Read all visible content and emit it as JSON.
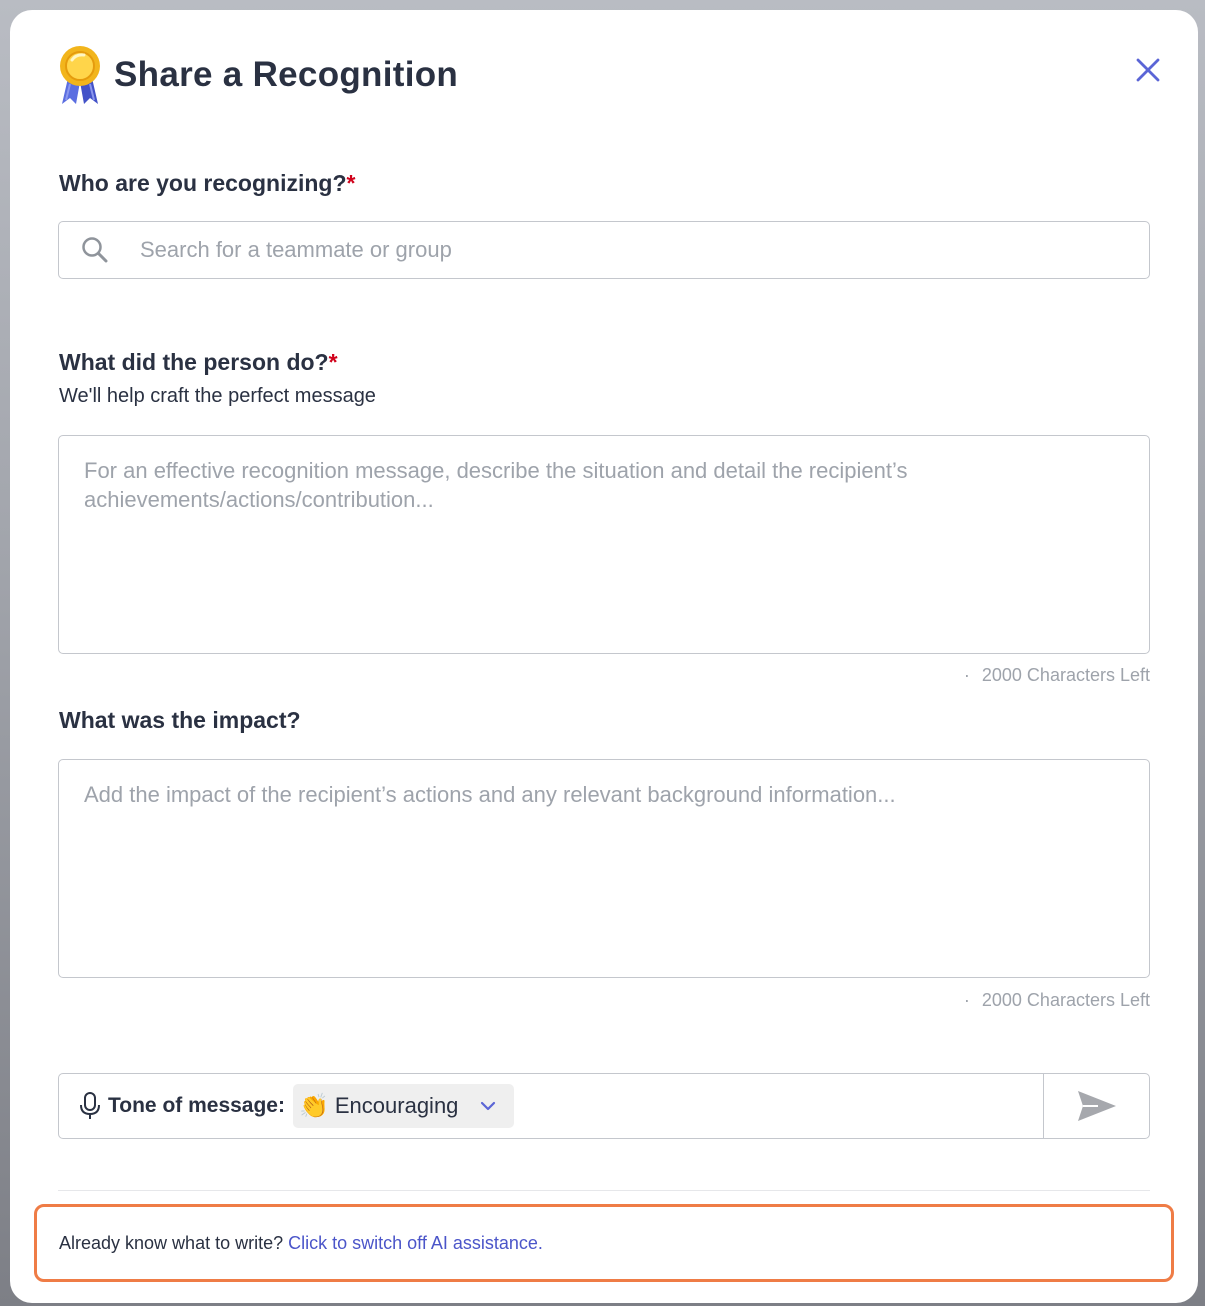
{
  "modal": {
    "title": "Share a Recognition",
    "title_icon": "medal-icon",
    "close_icon": "close-icon"
  },
  "recipient": {
    "label": "Who are you recognizing?",
    "required_mark": "*",
    "search_placeholder": "Search for a teammate or group",
    "search_value": ""
  },
  "action": {
    "label": "What did the person do?",
    "required_mark": "*",
    "helper": "We'll help craft the perfect message",
    "placeholder": "For an effective recognition message, describe the situation and detail the recipient’s achievements/actions/contribution...",
    "value": "",
    "counter_dot": "·",
    "counter": "2000 Characters Left"
  },
  "impact": {
    "label": "What was the impact?",
    "placeholder": "Add the impact of the recipient’s actions and any relevant background information...",
    "value": "",
    "counter_dot": "·",
    "counter": "2000 Characters Left"
  },
  "tone": {
    "label": "Tone of message:",
    "selected_emoji": "👏",
    "selected_value": "Encouraging",
    "mic_icon": "microphone-icon",
    "dropdown_icon": "chevron-down-icon",
    "send_icon": "send-icon"
  },
  "footer": {
    "text": "Already know what to write?",
    "link": "Click to switch off AI assistance.",
    "highlight_color": "#ef7c46"
  },
  "colors": {
    "accent": "#4b55c9",
    "required": "#d0021b",
    "text": "#2a3142",
    "placeholder": "#9ea3ab"
  }
}
